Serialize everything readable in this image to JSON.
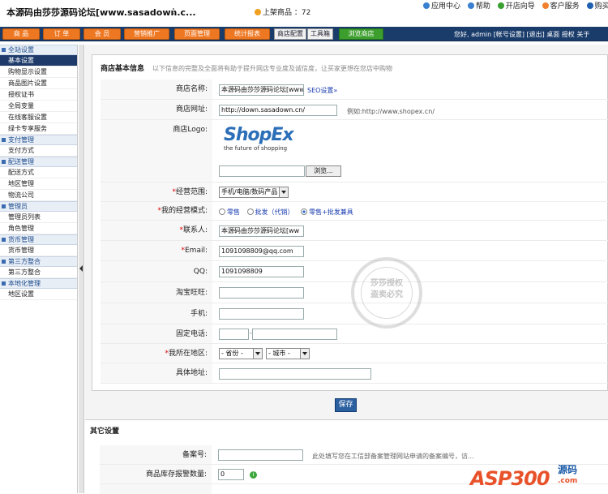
{
  "window": {
    "title": "本源码由莎莎源码论坛[www.sasadown.c..."
  },
  "topbar": {
    "onsale_label": "上架商品 ：72",
    "links": [
      {
        "label": "应用中心",
        "icon": "app-center-icon",
        "color": "#3a80d0"
      },
      {
        "label": "帮助",
        "icon": "help-icon",
        "color": "#3a80d0"
      },
      {
        "label": "开店向导",
        "icon": "wizard-icon",
        "color": "#3aa030"
      },
      {
        "label": "客户服务",
        "icon": "service-icon",
        "color": "#f08030"
      },
      {
        "label": "购买",
        "icon": "buy-icon",
        "color": "#2060b0"
      }
    ]
  },
  "nav": {
    "orange_tabs": [
      "商 品",
      "订 单",
      "会 员",
      "营销推广",
      "页面管理",
      "统计报表"
    ],
    "white_tabs": [
      "商店配置",
      "工具箱"
    ],
    "green_tab": "浏览商店",
    "user_info": "您好, admin  [帐号设置]  [退出]  桌面  授权  关于",
    "accent": "#ee7722",
    "bar_color": "#1a3c6b"
  },
  "sidebar": {
    "groups": [
      {
        "title": "全站设置",
        "items": [
          "基本设置",
          "购物显示设置",
          "商品图片设置",
          "授权证书",
          "全局变量",
          "在线客服设置",
          "绿卡专享服务"
        ]
      },
      {
        "title": "支付管理",
        "items": [
          "支付方式"
        ]
      },
      {
        "title": "配送管理",
        "items": [
          "配送方式",
          "地区管理",
          "物流公司"
        ]
      },
      {
        "title": "管理员",
        "items": [
          "管理员列表",
          "角色管理"
        ]
      },
      {
        "title": "货币管理",
        "items": [
          "货币管理"
        ]
      },
      {
        "title": "第三方整合",
        "items": [
          "第三方整合"
        ]
      },
      {
        "title": "本地化管理",
        "items": [
          "地区设置"
        ]
      }
    ],
    "active": "基本设置"
  },
  "store_info": {
    "heading": "商店基本信息",
    "heading_hint": "以下信息的完整及全面将有助于提升网店专业度及诚信度，让买家更想在您店中购物",
    "fields": {
      "name_label": "商店名称:",
      "name_value": "本源码由莎莎源码论坛[www",
      "seo_link": "SEO设置»",
      "url_label": "商店网址:",
      "url_value": "http://down.sasadown.cn/",
      "url_example": "例如:http://www.shopex.cn/",
      "logo_label": "商店Logo:",
      "logo_text": "ShopEx",
      "logo_tagline": "the future of shopping",
      "browse_button": "浏览...",
      "scope_label": "经营范围:",
      "scope_value": "手机/电脑/数码产品",
      "mode_label": "我的经营模式:",
      "mode_options": [
        "零售",
        "批发（代销）",
        "零售+批发兼具"
      ],
      "mode_selected": "零售+批发兼具",
      "contact_label": "联系人:",
      "contact_value": "本源码由莎莎源码论坛[ww",
      "email_label": "Email:",
      "email_value": "1091098809@qq.com",
      "qq_label": "QQ:",
      "qq_value": "1091098809",
      "wangwang_label": "淘宝旺旺:",
      "mobile_label": "手机:",
      "phone_label": "固定电话:",
      "phone_sep": "-",
      "region_label": "我所在地区:",
      "province_placeholder": "- 省份 -",
      "city_placeholder": "- 城市 -",
      "address_label": "具体地址:"
    },
    "save_button": "保存"
  },
  "other_settings": {
    "heading": "其它设置",
    "icp_label": "备案号:",
    "icp_hint": "此处填写您在工信部备案管理网站申请的备案编号，访...",
    "stock_label": "商品库存报警数量:",
    "stock_value": "0"
  },
  "watermark": {
    "line1": "莎莎授权",
    "line2": "盗卖必究"
  },
  "brand_logo": {
    "main": "ASP300",
    "cn": "源码",
    "domain": ".com"
  }
}
